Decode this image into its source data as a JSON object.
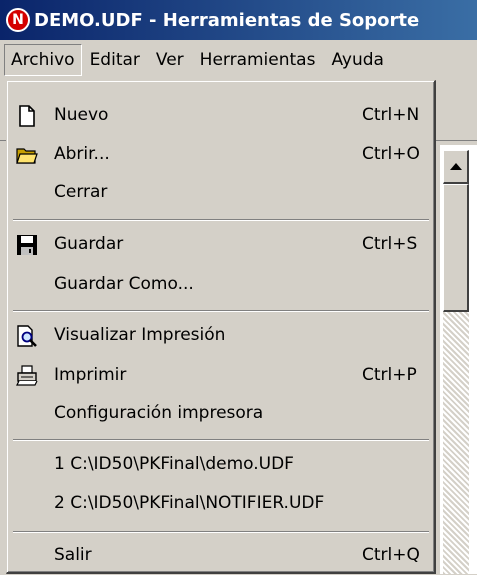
{
  "window": {
    "title": "DEMO.UDF - Herramientas de Soporte",
    "app_icon_letter": "N"
  },
  "menubar": {
    "items": [
      {
        "label": "Archivo"
      },
      {
        "label": "Editar"
      },
      {
        "label": "Ver"
      },
      {
        "label": "Herramientas"
      },
      {
        "label": "Ayuda"
      }
    ]
  },
  "file_menu": {
    "items": [
      {
        "label": "Nuevo",
        "shortcut": "Ctrl+N",
        "icon": "new-document-icon"
      },
      {
        "label": "Abrir...",
        "shortcut": "Ctrl+O",
        "icon": "open-folder-icon"
      },
      {
        "label": "Cerrar",
        "shortcut": "",
        "icon": ""
      },
      {
        "label": "Guardar",
        "shortcut": "Ctrl+S",
        "icon": "floppy-disk-icon"
      },
      {
        "label": "Guardar Como...",
        "shortcut": "",
        "icon": ""
      },
      {
        "label": "Visualizar Impresión",
        "shortcut": "",
        "icon": "print-preview-icon"
      },
      {
        "label": "Imprimir",
        "shortcut": "Ctrl+P",
        "icon": "printer-icon"
      },
      {
        "label": "Configuración impresora",
        "shortcut": "",
        "icon": ""
      },
      {
        "label": "1 C:\\ID50\\PKFinal\\demo.UDF",
        "shortcut": "",
        "icon": ""
      },
      {
        "label": "2 C:\\ID50\\PKFinal\\NOTIFIER.UDF",
        "shortcut": "",
        "icon": ""
      },
      {
        "label": "Salir",
        "shortcut": "Ctrl+Q",
        "icon": ""
      }
    ]
  },
  "colors": {
    "titlebar_start": "#0a246a",
    "titlebar_end": "#3a6ea5",
    "menu_bg": "#d4d0c8",
    "app_icon": "#d40000"
  }
}
